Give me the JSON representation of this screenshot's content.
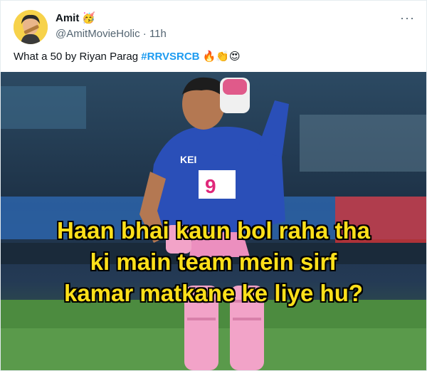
{
  "author": {
    "name": "Amit",
    "name_emoji": "🥳",
    "handle": "@AmitMovieHolic",
    "separator": "·",
    "time": "11h"
  },
  "more_menu": "···",
  "tweet": {
    "text": "What a 50 by Riyan Parag ",
    "hashtag": "#RRVSRCB",
    "emojis": "🔥👏😍"
  },
  "media": {
    "caption_lines": [
      "Haan bhai kaun bol raha tha",
      "ki main team mein sirf",
      "kamar matkane ke liye hu?"
    ],
    "jersey_text": "KEI",
    "sponsor_text": "9"
  },
  "colors": {
    "hashtag": "#1d9bf0",
    "caption": "#ffe01a",
    "jersey": "#2a4fb8",
    "pads": "#f2a3c8"
  }
}
